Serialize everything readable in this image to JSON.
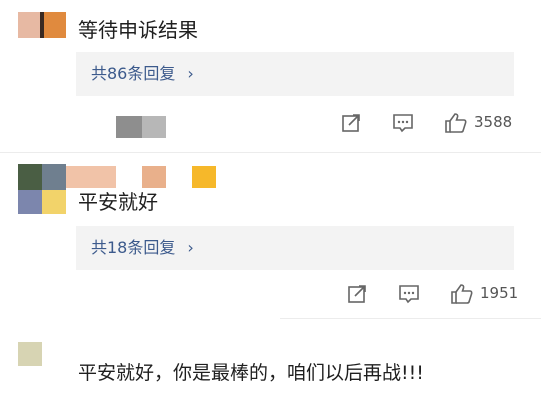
{
  "comments": [
    {
      "text": "等待申诉结果",
      "reply_summary": "共86条回复",
      "like_count": "3588"
    },
    {
      "text": "平安就好",
      "reply_summary": "共18条回复",
      "like_count": "1951"
    },
    {
      "text": "平安就好，你是最棒的，咱们以后再战!!!"
    }
  ],
  "icons": {
    "share": "share-icon",
    "comment": "comment-icon",
    "like": "thumbs-up-icon",
    "chevron": "chevron-right-icon"
  },
  "colors": {
    "link_blue": "#3c5a8c",
    "reply_bg": "#f3f3f3",
    "text": "#1f1f1f",
    "muted": "#555555"
  }
}
